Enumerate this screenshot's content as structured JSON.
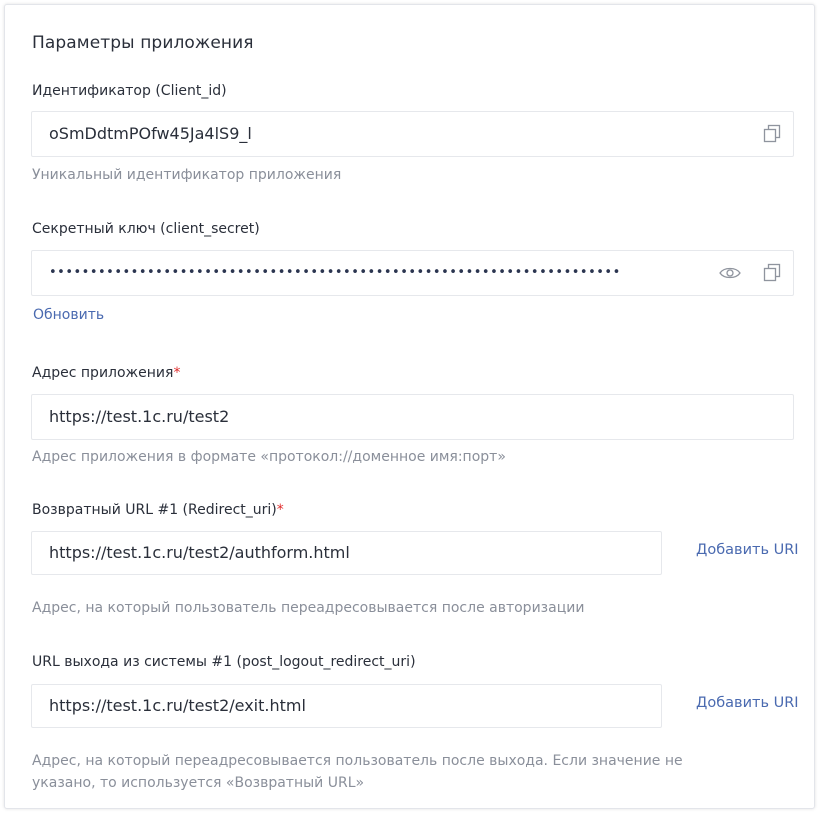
{
  "section": {
    "title": "Параметры приложения"
  },
  "client_id": {
    "label": "Идентификатор (Client_id)",
    "value": "oSmDdtmPOfw45Ja4lS9_l",
    "hint": "Уникальный идентификатор приложения"
  },
  "client_secret": {
    "label": "Секретный ключ (client_secret)",
    "masked_value": "••••••••••••••••••••••••••••••••••••••••••••••••••••••••••••••••••••••",
    "refresh_link": "Обновить"
  },
  "app_address": {
    "label": "Адрес приложения",
    "required_mark": "*",
    "value": "https://test.1c.ru/test2",
    "hint": "Адрес приложения в формате «протокол://доменное имя:порт»"
  },
  "redirect_uri": {
    "label": "Возвратный URL #1 (Redirect_uri)",
    "required_mark": "*",
    "value": "https://test.1c.ru/test2/authform.html",
    "add_link": "Добавить URI",
    "hint": "Адрес, на который пользователь переадресовывается после авторизации"
  },
  "logout_uri": {
    "label": "URL выхода из системы #1 (post_logout_redirect_uri)",
    "value": "https://test.1c.ru/test2/exit.html",
    "add_link": "Добавить URI",
    "hint_line1": "Адрес, на который переадресовывается пользователь после выхода. Если значение не",
    "hint_line2": "указано, то используется «Возвратный URL»"
  },
  "icons": {
    "copy": "copy-icon",
    "eye": "eye-icon"
  },
  "colors": {
    "link": "#4a6ab0",
    "required": "#e02b2b",
    "hint": "#8a8f9a",
    "border": "#e6e8ec"
  }
}
